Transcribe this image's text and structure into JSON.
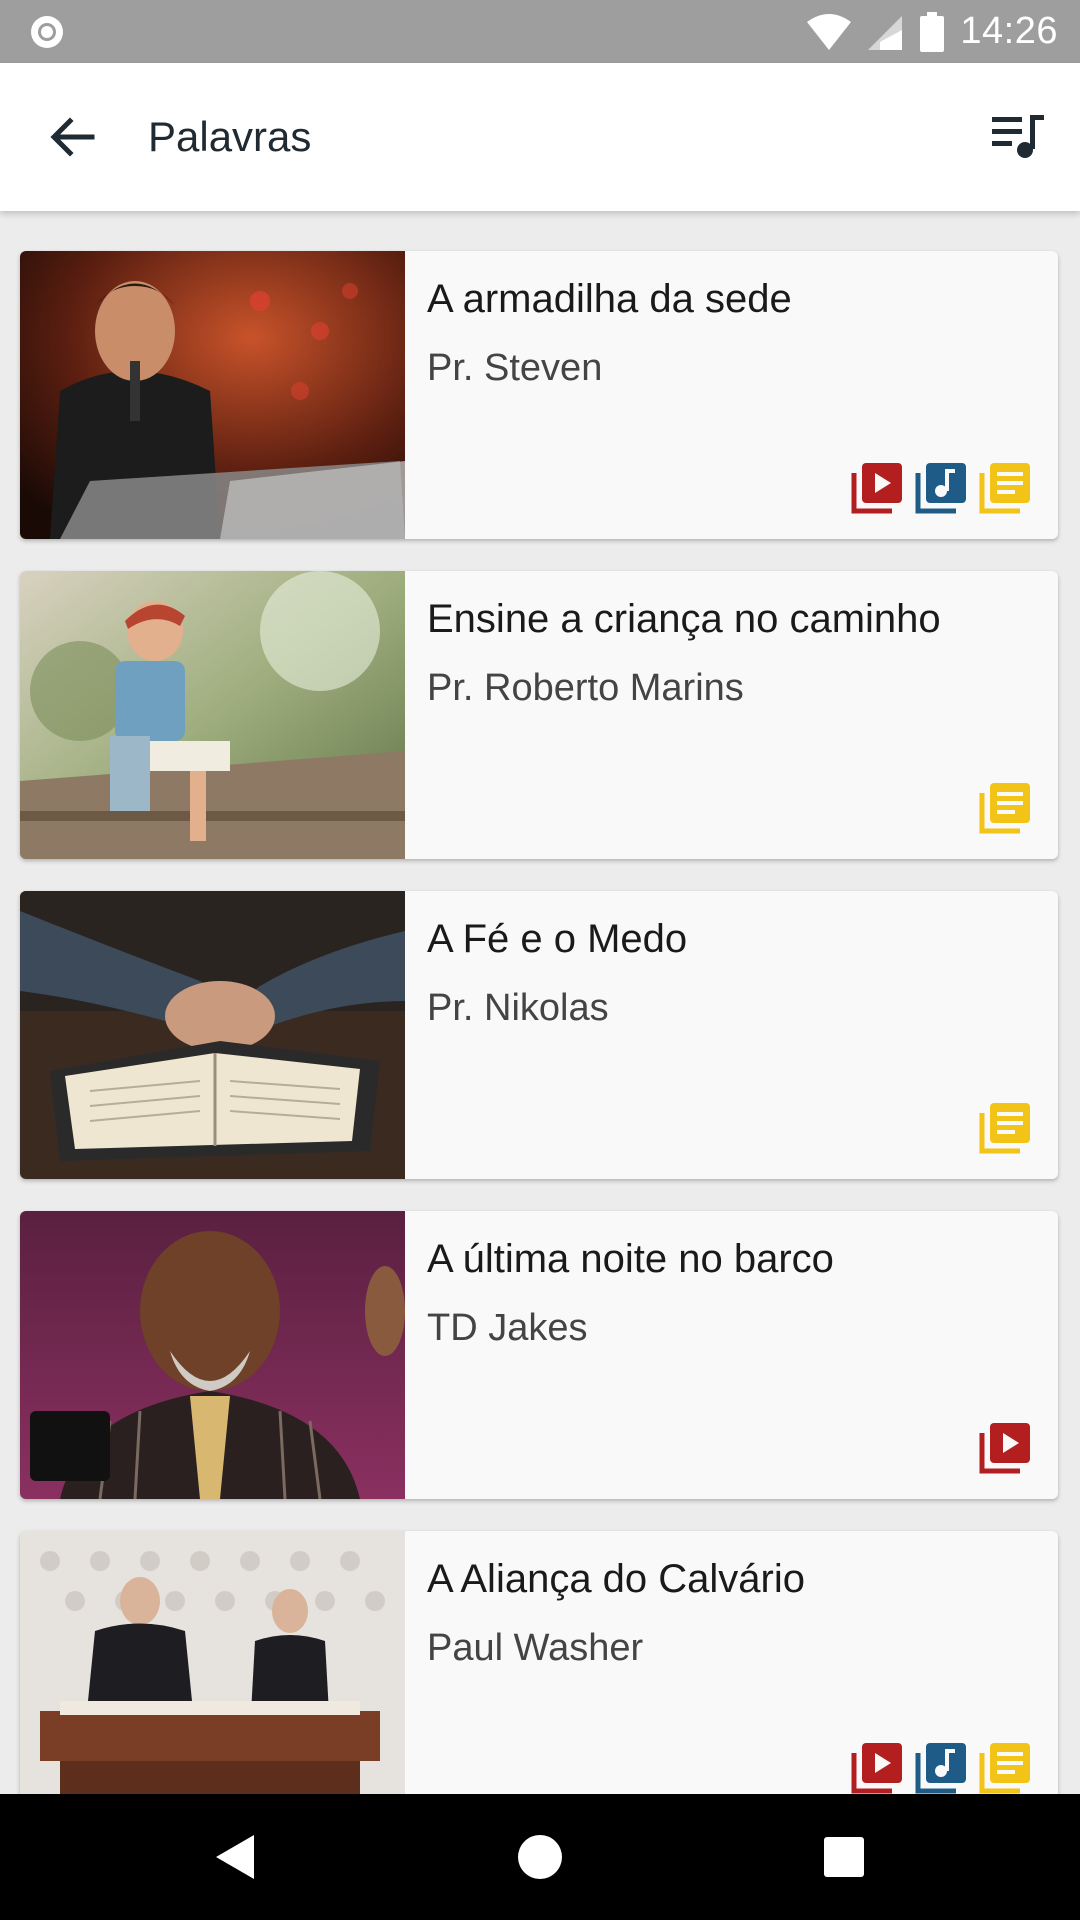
{
  "status_bar": {
    "time": "14:26",
    "icons": [
      "notification-ring-icon",
      "wifi-icon",
      "signal-icon",
      "battery-icon"
    ]
  },
  "app_bar": {
    "title": "Palavras",
    "back_icon": "arrow-back-icon",
    "queue_icon": "playlist-music-icon"
  },
  "colors": {
    "video": "#b31e1e",
    "audio": "#1e5b86",
    "text": "#f2c417",
    "status_bar": "#9e9e9e"
  },
  "cards": [
    {
      "title": "A armadilha da sede",
      "author": "Pr. Steven",
      "badges": [
        "video",
        "audio",
        "text"
      ]
    },
    {
      "title": "Ensine a criança no caminho",
      "author": "Pr. Roberto Marins",
      "badges": [
        "text"
      ]
    },
    {
      "title": "A Fé e o Medo",
      "author": "Pr. Nikolas",
      "badges": [
        "text"
      ]
    },
    {
      "title": "A última noite no barco",
      "author": "TD Jakes",
      "badges": [
        "video"
      ]
    },
    {
      "title": "A Aliança do Calvário",
      "author": "Paul Washer",
      "badges": [
        "video",
        "audio",
        "text"
      ]
    }
  ],
  "nav_bar": {
    "icons": [
      "back-triangle-icon",
      "home-circle-icon",
      "recents-square-icon"
    ]
  }
}
